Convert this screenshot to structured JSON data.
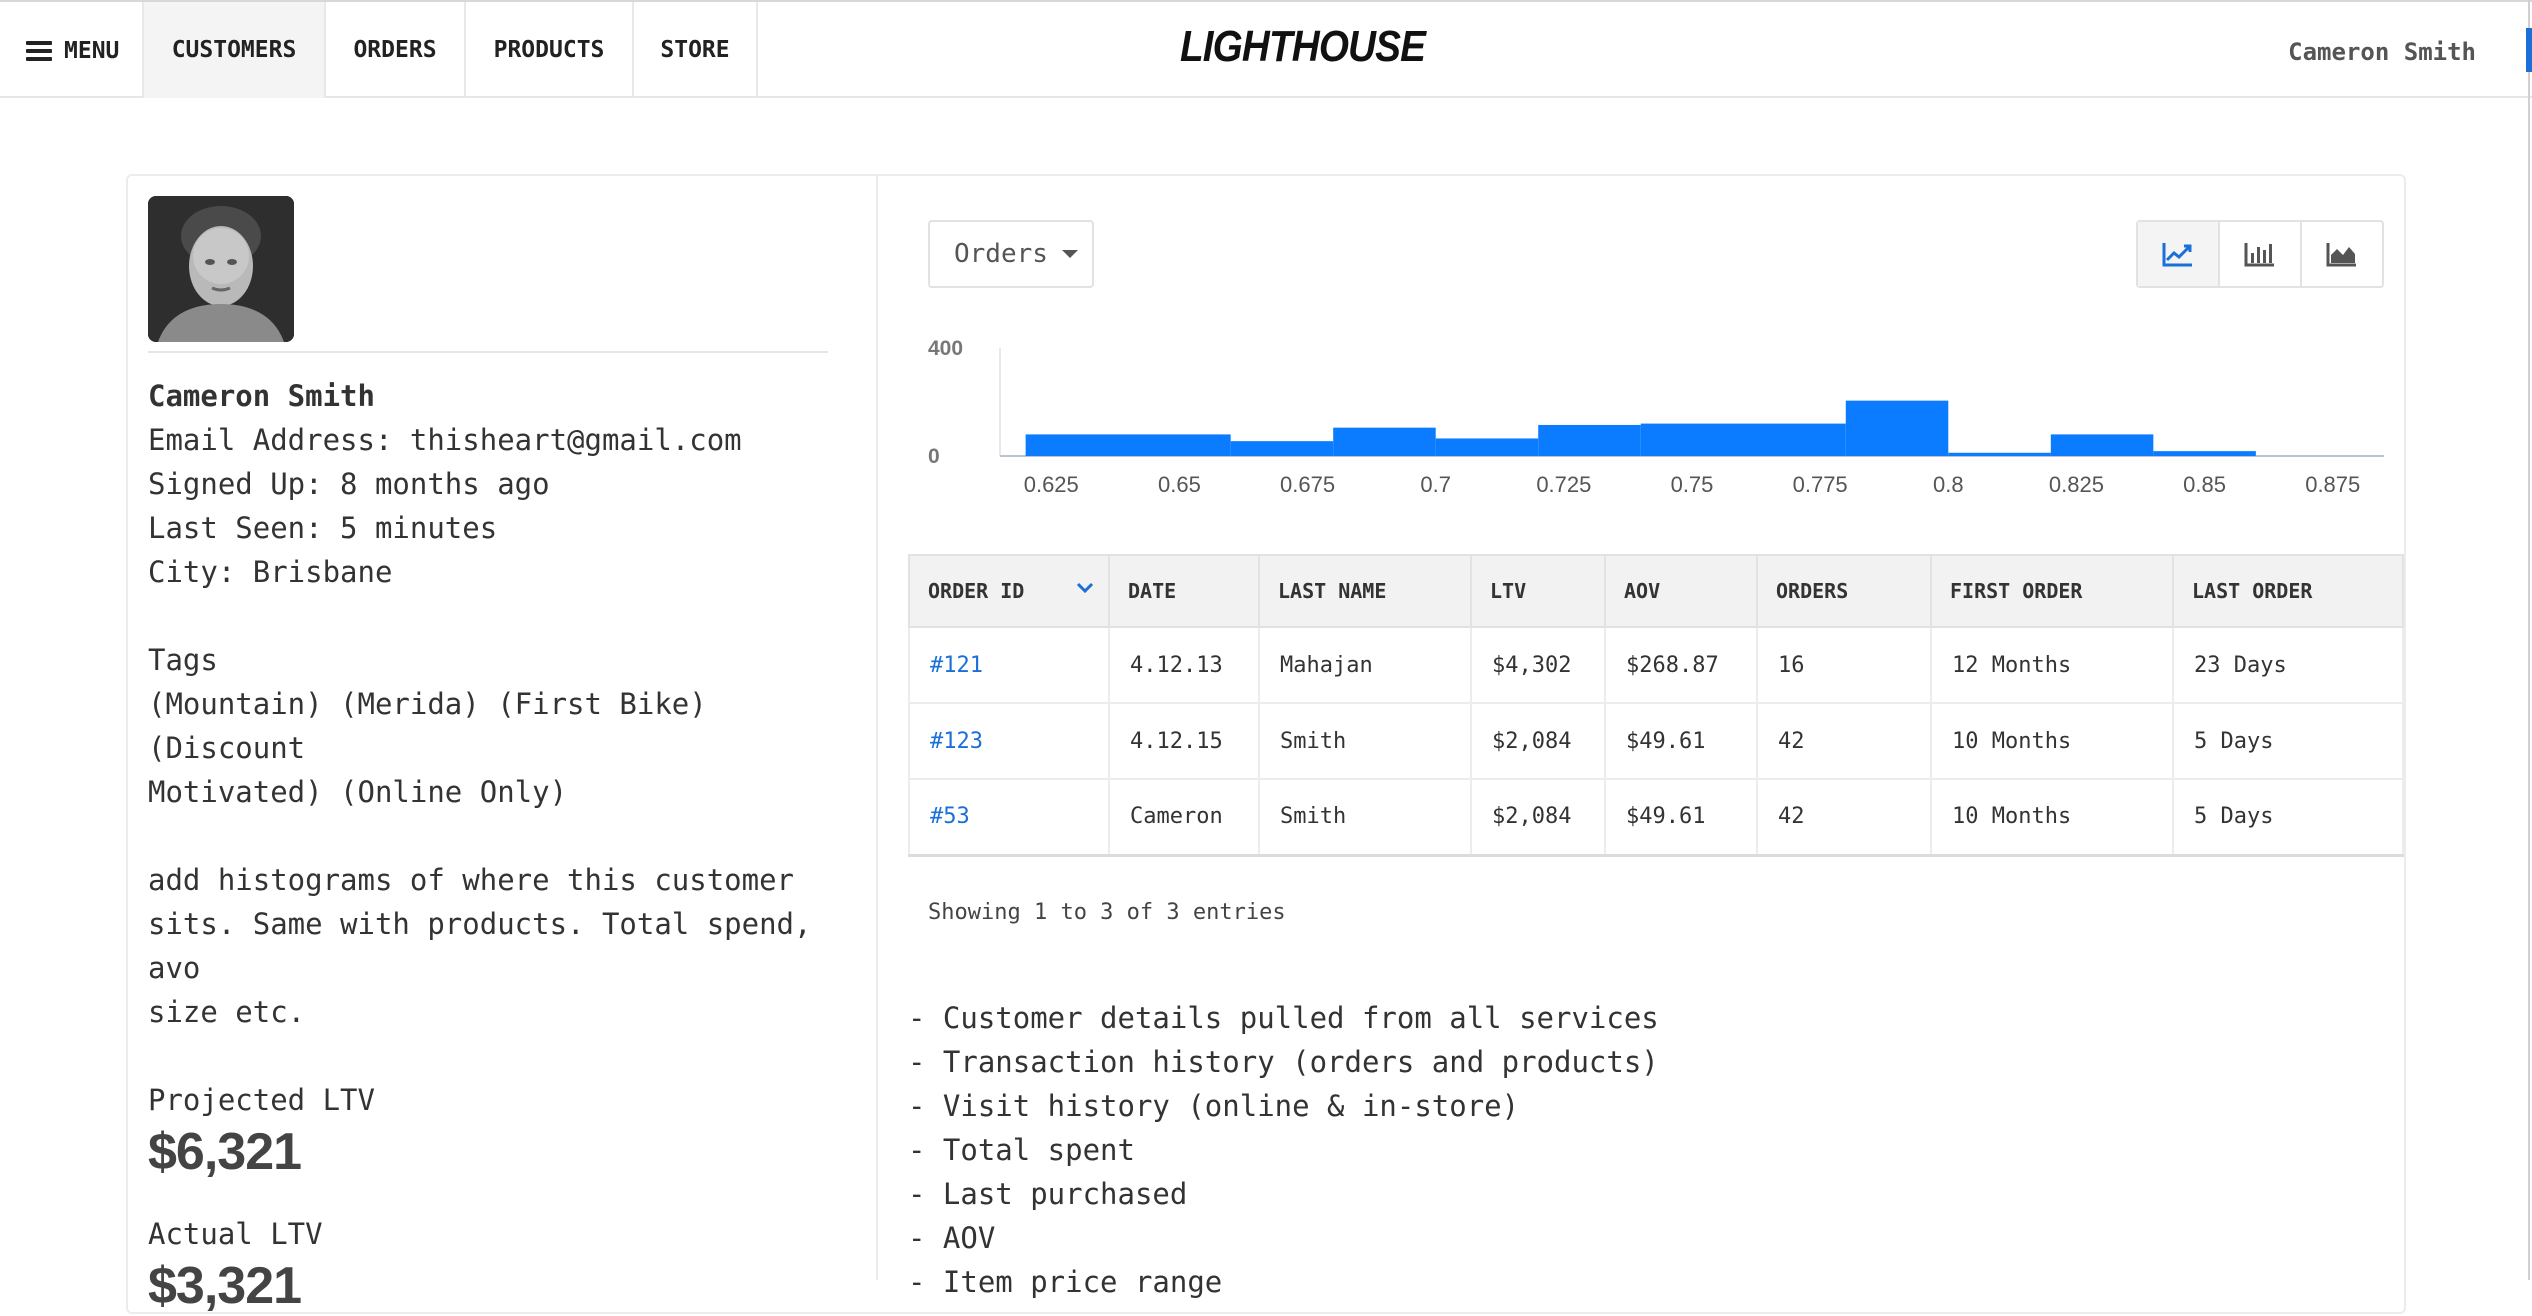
{
  "nav": {
    "menu_label": "MENU",
    "tabs": [
      {
        "label": "CUSTOMERS",
        "active": true
      },
      {
        "label": "ORDERS",
        "active": false
      },
      {
        "label": "PRODUCTS",
        "active": false
      },
      {
        "label": "STORE",
        "active": false
      }
    ],
    "logo": "LIGHTHOUSE",
    "user_name": "Cameron Smith"
  },
  "profile": {
    "name": "Cameron Smith",
    "email": "Email Address: thisheart@gmail.com",
    "signed_up": "Signed Up: 8 months ago",
    "last_seen": "Last Seen: 5 minutes",
    "city": "City: Brisbane",
    "tags_heading": "Tags",
    "tags_line1": "(Mountain) (Merida) (First Bike) (Discount",
    "tags_line2": "Motivated) (Online Only)",
    "note_line1": "add histograms of where this customer",
    "note_line2": "sits. Same with products. Total spend, avo",
    "note_line3": "size etc.",
    "projected_label": "Projected LTV",
    "projected_value": "$6,321",
    "actual_label": "Actual LTV",
    "actual_value": "$3,321"
  },
  "chart_controls": {
    "dropdown_value": "Orders",
    "view_buttons": [
      "line-chart-icon",
      "bar-chart-icon",
      "area-chart-icon"
    ],
    "active_view": "line-chart-icon"
  },
  "chart_data": {
    "type": "bar",
    "ytick_labels": [
      "0",
      "400"
    ],
    "ylim": [
      0,
      400
    ],
    "xlim": [
      0.615,
      0.885
    ],
    "xtick_labels": [
      "0.625",
      "0.65",
      "0.675",
      "0.7",
      "0.725",
      "0.75",
      "0.775",
      "0.8",
      "0.825",
      "0.85",
      "0.875"
    ],
    "xticks": [
      0.625,
      0.65,
      0.675,
      0.7,
      0.725,
      0.75,
      0.775,
      0.8,
      0.825,
      0.85,
      0.875
    ],
    "bins": [
      {
        "x0": 0.62,
        "x1": 0.66,
        "value": 80
      },
      {
        "x0": 0.66,
        "x1": 0.68,
        "value": 55
      },
      {
        "x0": 0.68,
        "x1": 0.7,
        "value": 105
      },
      {
        "x0": 0.7,
        "x1": 0.72,
        "value": 65
      },
      {
        "x0": 0.72,
        "x1": 0.74,
        "value": 115
      },
      {
        "x0": 0.74,
        "x1": 0.78,
        "value": 120
      },
      {
        "x0": 0.78,
        "x1": 0.8,
        "value": 205
      },
      {
        "x0": 0.8,
        "x1": 0.82,
        "value": 12
      },
      {
        "x0": 0.82,
        "x1": 0.84,
        "value": 80
      },
      {
        "x0": 0.84,
        "x1": 0.86,
        "value": 18
      }
    ],
    "color": "#0b7bff",
    "grid": false,
    "legend": "none"
  },
  "table": {
    "columns": [
      "ORDER ID",
      "DATE",
      "LAST NAME",
      "LTV",
      "AOV",
      "ORDERS",
      "FIRST ORDER",
      "LAST ORDER"
    ],
    "rows": [
      [
        "#121",
        "4.12.13",
        "Mahajan",
        "$4,302",
        "$268.87",
        "16",
        "12 Months",
        "23 Days"
      ],
      [
        "#123",
        "4.12.15",
        "Smith",
        "$2,084",
        "$49.61",
        "42",
        "10 Months",
        "5 Days"
      ],
      [
        "#53",
        "Cameron",
        "Smith",
        "$2,084",
        "$49.61",
        "42",
        "10 Months",
        "5 Days"
      ]
    ],
    "entries_text": "Showing 1 to 3 of 3 entries"
  },
  "notes": [
    "- Customer details pulled from all services",
    "- Transaction history (orders and products)",
    "- Visit history (online & in-store)",
    "- Total spent",
    "- Last purchased",
    "- AOV",
    "- Item price range"
  ],
  "colors": {
    "accent": "#1a6fd8",
    "bar": "#0b7bff"
  }
}
